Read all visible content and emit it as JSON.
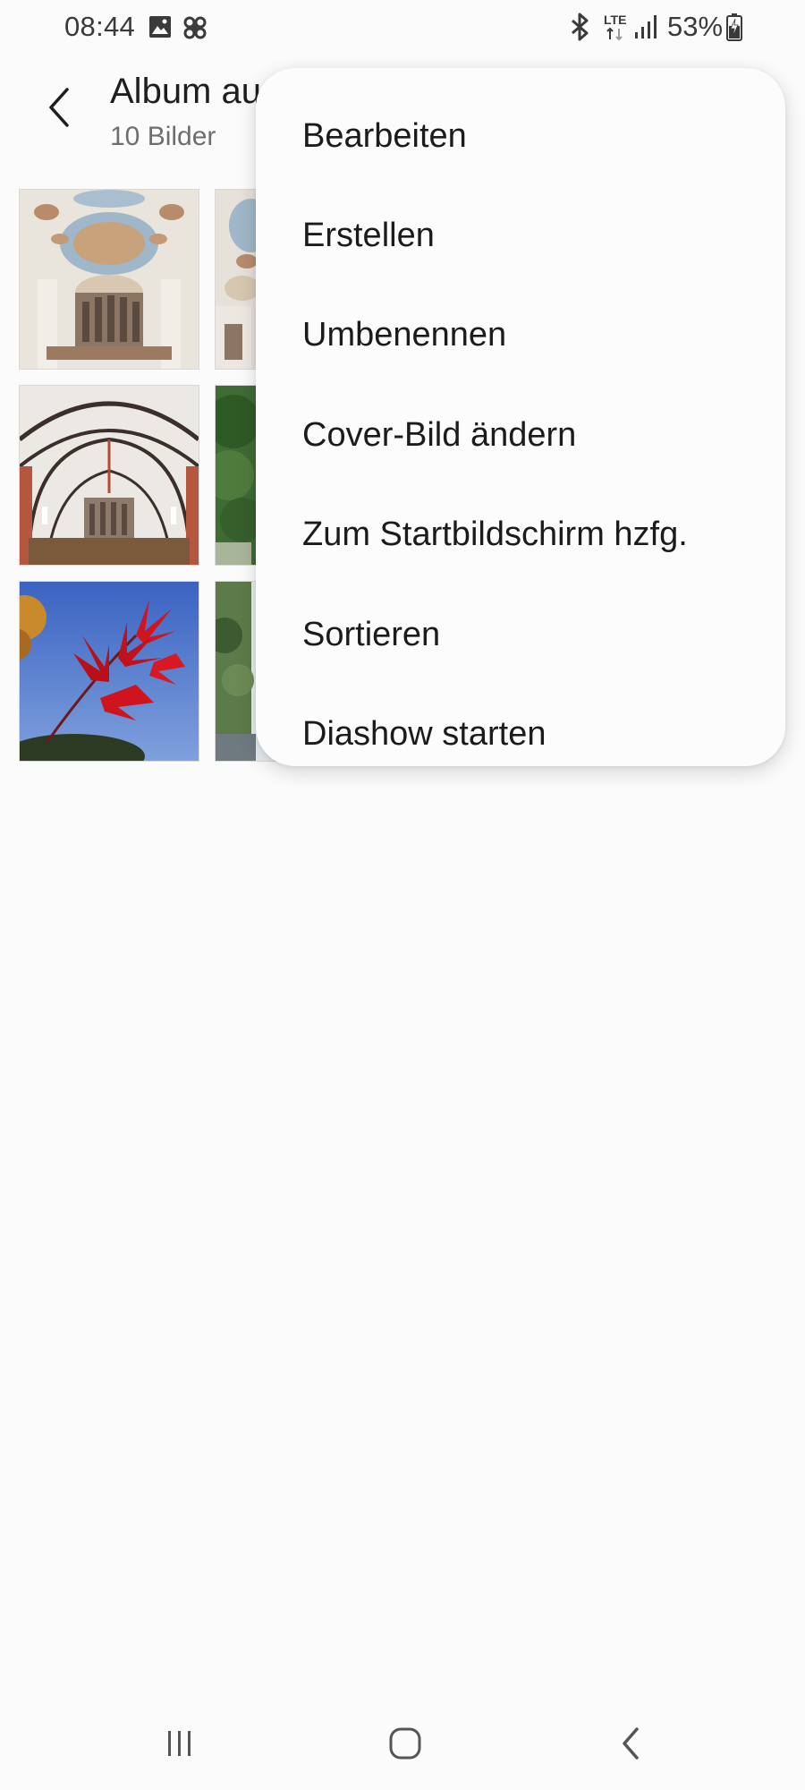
{
  "status_bar": {
    "time": "08:44",
    "battery_percent": "53%",
    "network_label": "LTE",
    "icons": [
      "gallery-notification-icon",
      "fan-notification-icon",
      "bluetooth-icon",
      "lte-icon",
      "signal-icon",
      "battery-charging-icon"
    ]
  },
  "header": {
    "title": "Album au",
    "subtitle": "10 Bilder",
    "back_icon": "chevron-left-icon"
  },
  "grid": {
    "thumbnails": [
      {
        "subject": "baroque-church-ceiling-organ"
      },
      {
        "subject": "baroque-church-ceiling-partial"
      },
      {
        "subject": "gothic-church-vault-organ"
      },
      {
        "subject": "green-trees"
      },
      {
        "subject": "red-leaves-blue-sky"
      },
      {
        "subject": "trees-by-water"
      }
    ]
  },
  "menu": {
    "items": [
      {
        "label": "Bearbeiten"
      },
      {
        "label": "Erstellen"
      },
      {
        "label": "Umbenennen"
      },
      {
        "label": "Cover-Bild ändern"
      },
      {
        "label": "Zum Startbildschirm hzfg."
      },
      {
        "label": "Sortieren"
      },
      {
        "label": "Diashow starten"
      }
    ]
  },
  "navbar": {
    "buttons": [
      "recent-apps-icon",
      "home-icon",
      "back-icon"
    ]
  },
  "colors": {
    "background": "#fbfbfb",
    "menu_background": "#fcfcfc",
    "text_primary": "#1e1e1e",
    "text_secondary": "#6e6e6e"
  }
}
